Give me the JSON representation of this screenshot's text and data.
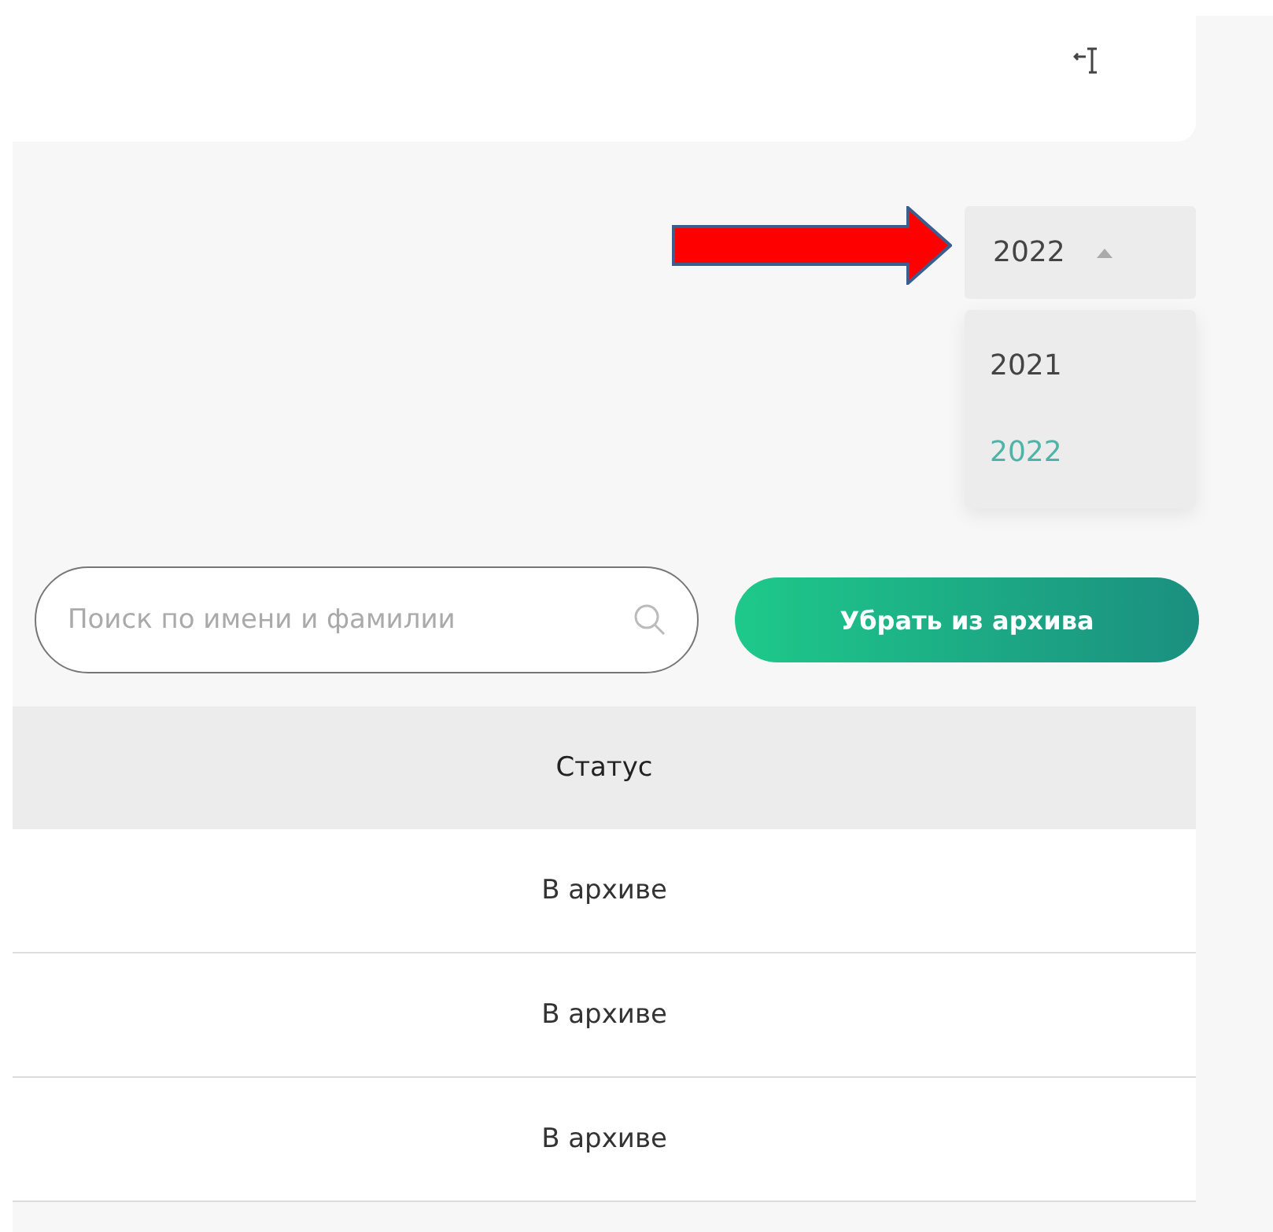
{
  "year_select": {
    "value": "2022",
    "expanded": true,
    "options": [
      {
        "label": "2021",
        "selected": false
      },
      {
        "label": "2022",
        "selected": true
      }
    ]
  },
  "search": {
    "placeholder": "Поиск по имени и фамилии"
  },
  "unarchive_button": {
    "label": "Убрать из архива"
  },
  "table": {
    "columns": [
      "Статус"
    ],
    "rows": [
      [
        "В архиве"
      ],
      [
        "В архиве"
      ],
      [
        "В архиве"
      ]
    ]
  }
}
